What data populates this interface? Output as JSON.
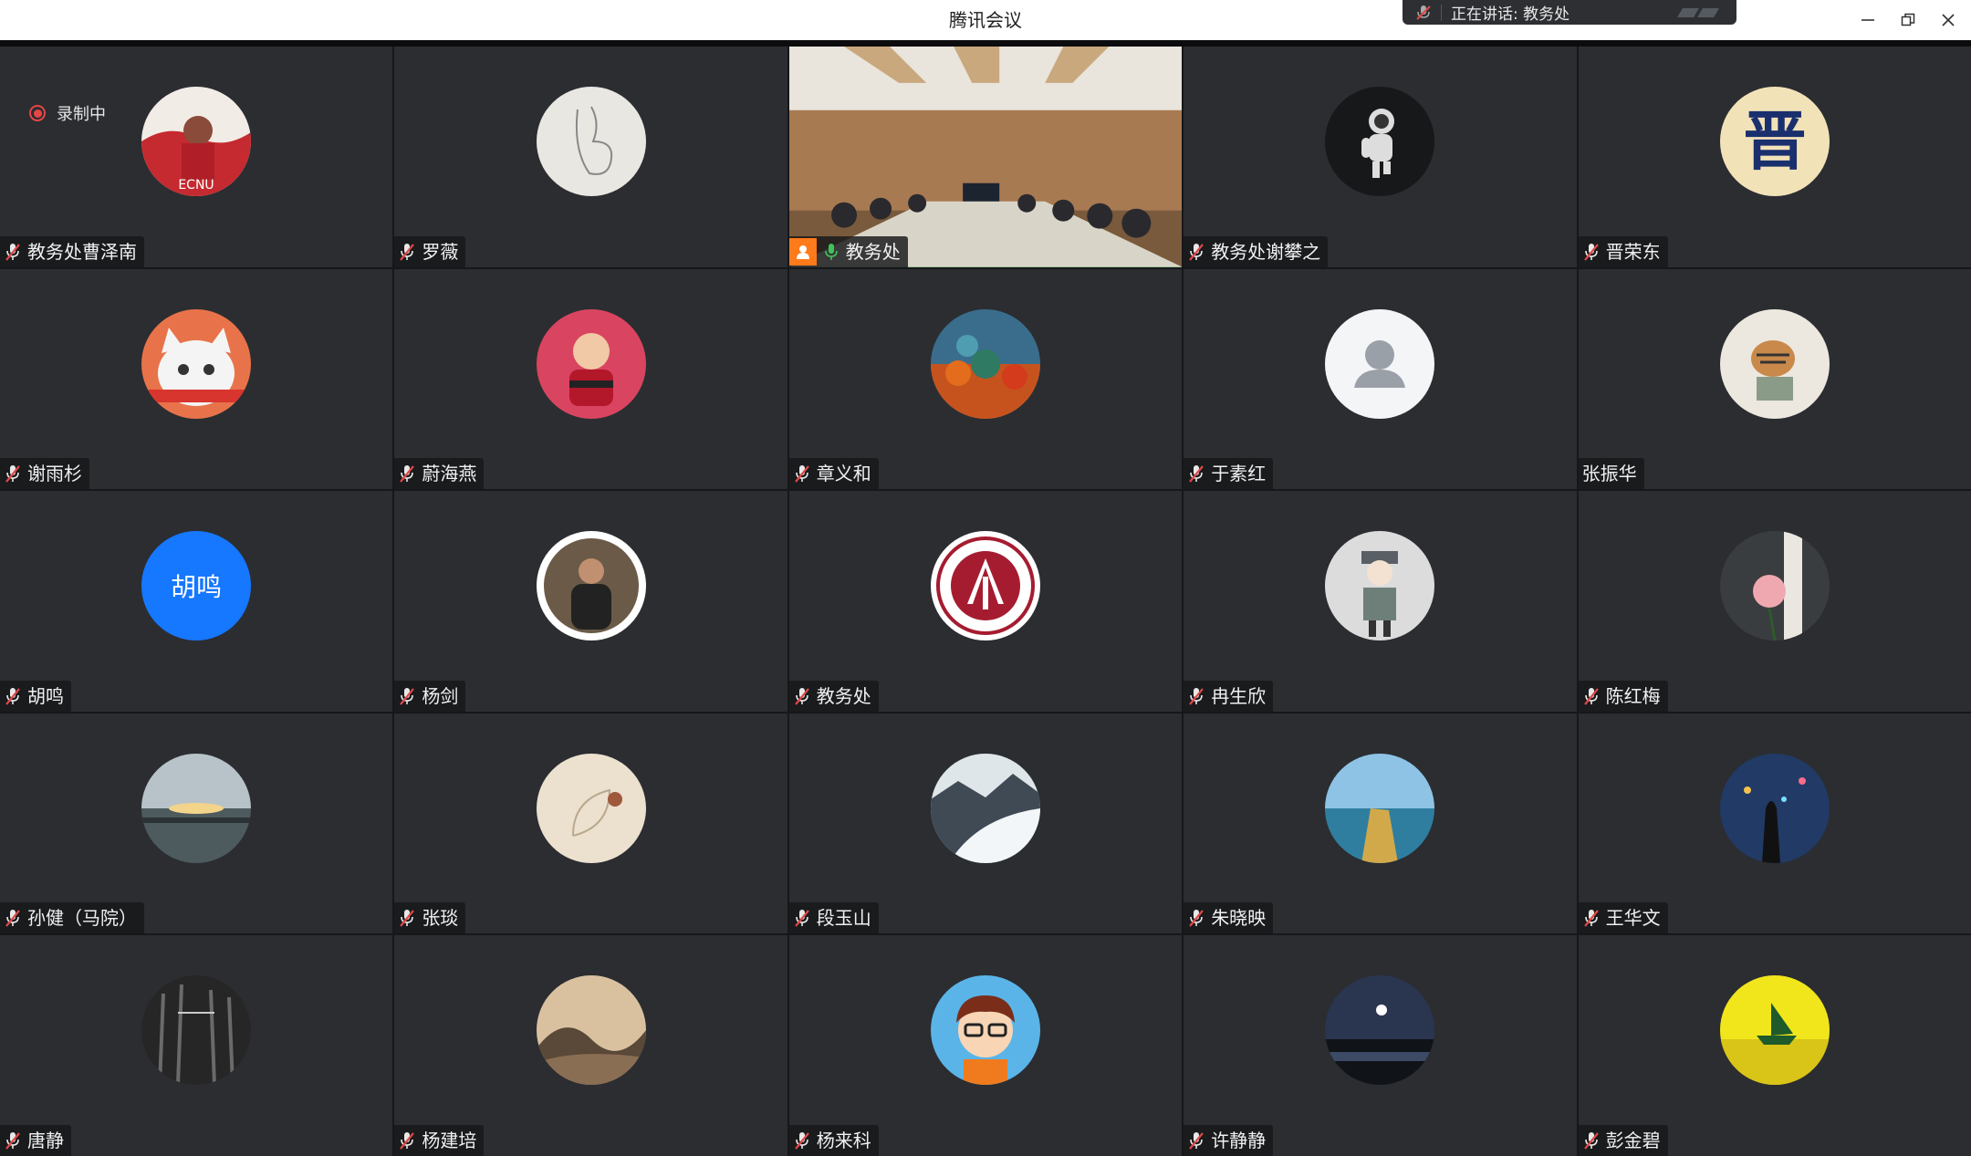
{
  "app": {
    "title": "腾讯会议"
  },
  "speaking": {
    "text": "正在讲话: 教务处"
  },
  "recording": {
    "label": "录制中"
  },
  "colors": {
    "muted_icon": "#e04848",
    "active_mic": "#3ec25a",
    "active_border": "#3ec25a",
    "host_badge": "#ff7a1a",
    "tile_bg": "#2b2d31"
  },
  "participants": [
    {
      "name": "教务处曹泽南",
      "avatar": "ecnu-photo-avatar",
      "muted": true
    },
    {
      "name": "罗薇",
      "avatar": "rabbit-sketch-avatar",
      "muted": true
    },
    {
      "name": "教务处",
      "avatar": "conference-room-video",
      "muted": false,
      "speaking": true,
      "host": true
    },
    {
      "name": "教务处谢攀之",
      "avatar": "astronaut-avatar",
      "muted": true
    },
    {
      "name": "晋荣东",
      "avatar": "jin-character-avatar",
      "muted": true
    },
    {
      "name": "谢雨杉",
      "avatar": "cat-avatar",
      "muted": true
    },
    {
      "name": "蔚海燕",
      "avatar": "baby-photo-avatar",
      "muted": true
    },
    {
      "name": "章义和",
      "avatar": "autumn-forest-avatar",
      "muted": true
    },
    {
      "name": "于素红",
      "avatar": "default-user-avatar",
      "muted": true
    },
    {
      "name": "张振华",
      "avatar": "tiger-painting-avatar",
      "muted": false
    },
    {
      "name": "胡鸣",
      "avatar_text": "胡鸣",
      "avatar": "text-avatar",
      "muted": true
    },
    {
      "name": "杨剑",
      "avatar": "person-photo-avatar",
      "muted": true
    },
    {
      "name": "教务处",
      "avatar": "ecnu-logo-avatar",
      "muted": true
    },
    {
      "name": "冉生欣",
      "avatar": "cartoon-man-avatar",
      "muted": true
    },
    {
      "name": "陈红梅",
      "avatar": "rose-avatar",
      "muted": true
    },
    {
      "name": "孙健（马院）",
      "avatar": "sunset-lake-avatar",
      "muted": true
    },
    {
      "name": "张琰",
      "avatar": "leaf-drawing-avatar",
      "muted": true
    },
    {
      "name": "段玉山",
      "avatar": "glacier-avatar",
      "muted": true
    },
    {
      "name": "朱晓映",
      "avatar": "seaside-avatar",
      "muted": true
    },
    {
      "name": "王华文",
      "avatar": "night-figures-avatar",
      "muted": true
    },
    {
      "name": "唐静",
      "avatar": "dark-forest-avatar",
      "muted": true
    },
    {
      "name": "杨建培",
      "avatar": "ink-landscape-avatar",
      "muted": true
    },
    {
      "name": "杨来科",
      "avatar": "cartoon-glasses-avatar",
      "muted": true
    },
    {
      "name": "许静静",
      "avatar": "moon-night-avatar",
      "muted": true
    },
    {
      "name": "彭金碧",
      "avatar": "yellow-boat-avatar",
      "muted": true
    }
  ]
}
